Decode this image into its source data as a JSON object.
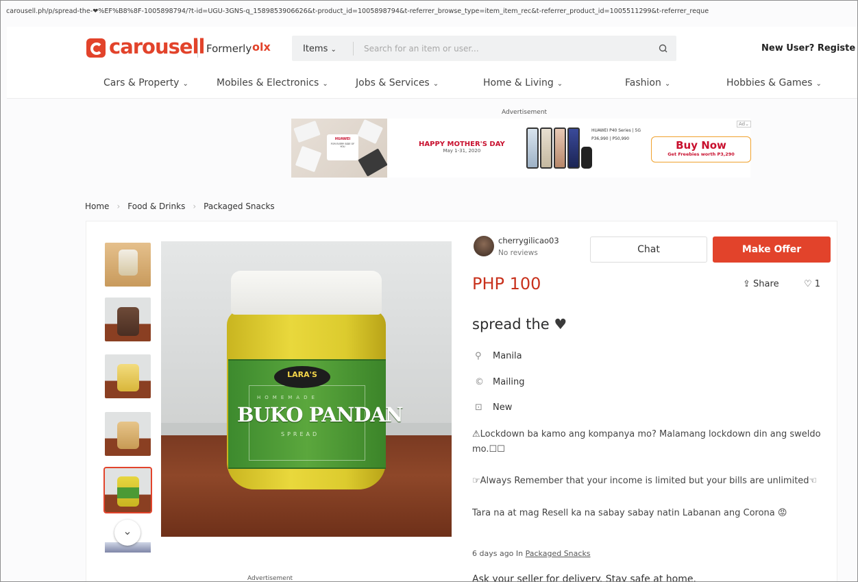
{
  "browser": {
    "url": "carousell.ph/p/spread-the-❤%EF%B8%8F-1005898794/?t-id=UGU-3GNS-q_1589853906626&t-product_id=1005898794&t-referrer_browse_type=item_item_rec&t-referrer_product_id=1005511299&t-referrer_reque"
  },
  "header": {
    "logo_text": "carousell",
    "formerly_label": "Formerly",
    "formerly_brand": "olx",
    "search_scope": "Items",
    "search_placeholder": "Search for an item or user...",
    "new_user_label": "New User? Registe"
  },
  "categories": [
    "Cars & Property",
    "Mobiles & Electronics",
    "Jobs & Services",
    "Home & Living",
    "Fashion",
    "Hobbies & Games"
  ],
  "advertisement": {
    "label": "Advertisement",
    "brand": "HUAWEI",
    "tagline": "FOR EVERY SIDE OF YOU",
    "headline": "HAPPY MOTHER'S DAY",
    "dates": "May 1-31, 2020",
    "spec_line1": "HUAWEI P40 Series | 5G",
    "spec_line2": "P36,990 | P50,990",
    "buy_label": "Buy Now",
    "buy_sub": "Get Freebies worth P3,290",
    "ad_chip": "Ad"
  },
  "breadcrumb": [
    "Home",
    "Food & Drinks",
    "Packaged Snacks"
  ],
  "product_image": {
    "label_brand": "LARA'S",
    "label_homemade": "HOMEMADE",
    "label_name": "BUKO PANDAN",
    "label_type": "SPREAD"
  },
  "seller": {
    "username": "cherrygilicao03",
    "reviews": "No reviews"
  },
  "actions": {
    "chat": "Chat",
    "make_offer": "Make Offer",
    "share": "Share",
    "likes": "1"
  },
  "listing": {
    "price": "PHP 100",
    "title": "spread the",
    "location": "Manila",
    "delivery": "Mailing",
    "condition": "New",
    "description": [
      "⚠Lockdown ba kamo ang kompanya mo? Malamang lockdown din ang sweldo mo.☐☐",
      "☞Always Remember that your income is limited but your bills are unlimited☜",
      "Tara na at mag Resell ka na sabay sabay natin Labanan ang Corona 😡"
    ],
    "posted_prefix": "6 days ago In",
    "posted_category": "Packaged Snacks",
    "delivery_note": "Ask your seller for delivery. Stay safe at home."
  },
  "bottom_ad_label": "Advertisement",
  "colors": {
    "brand": "#e2432b",
    "price": "#c8311c",
    "ad_red": "#c8102e"
  }
}
